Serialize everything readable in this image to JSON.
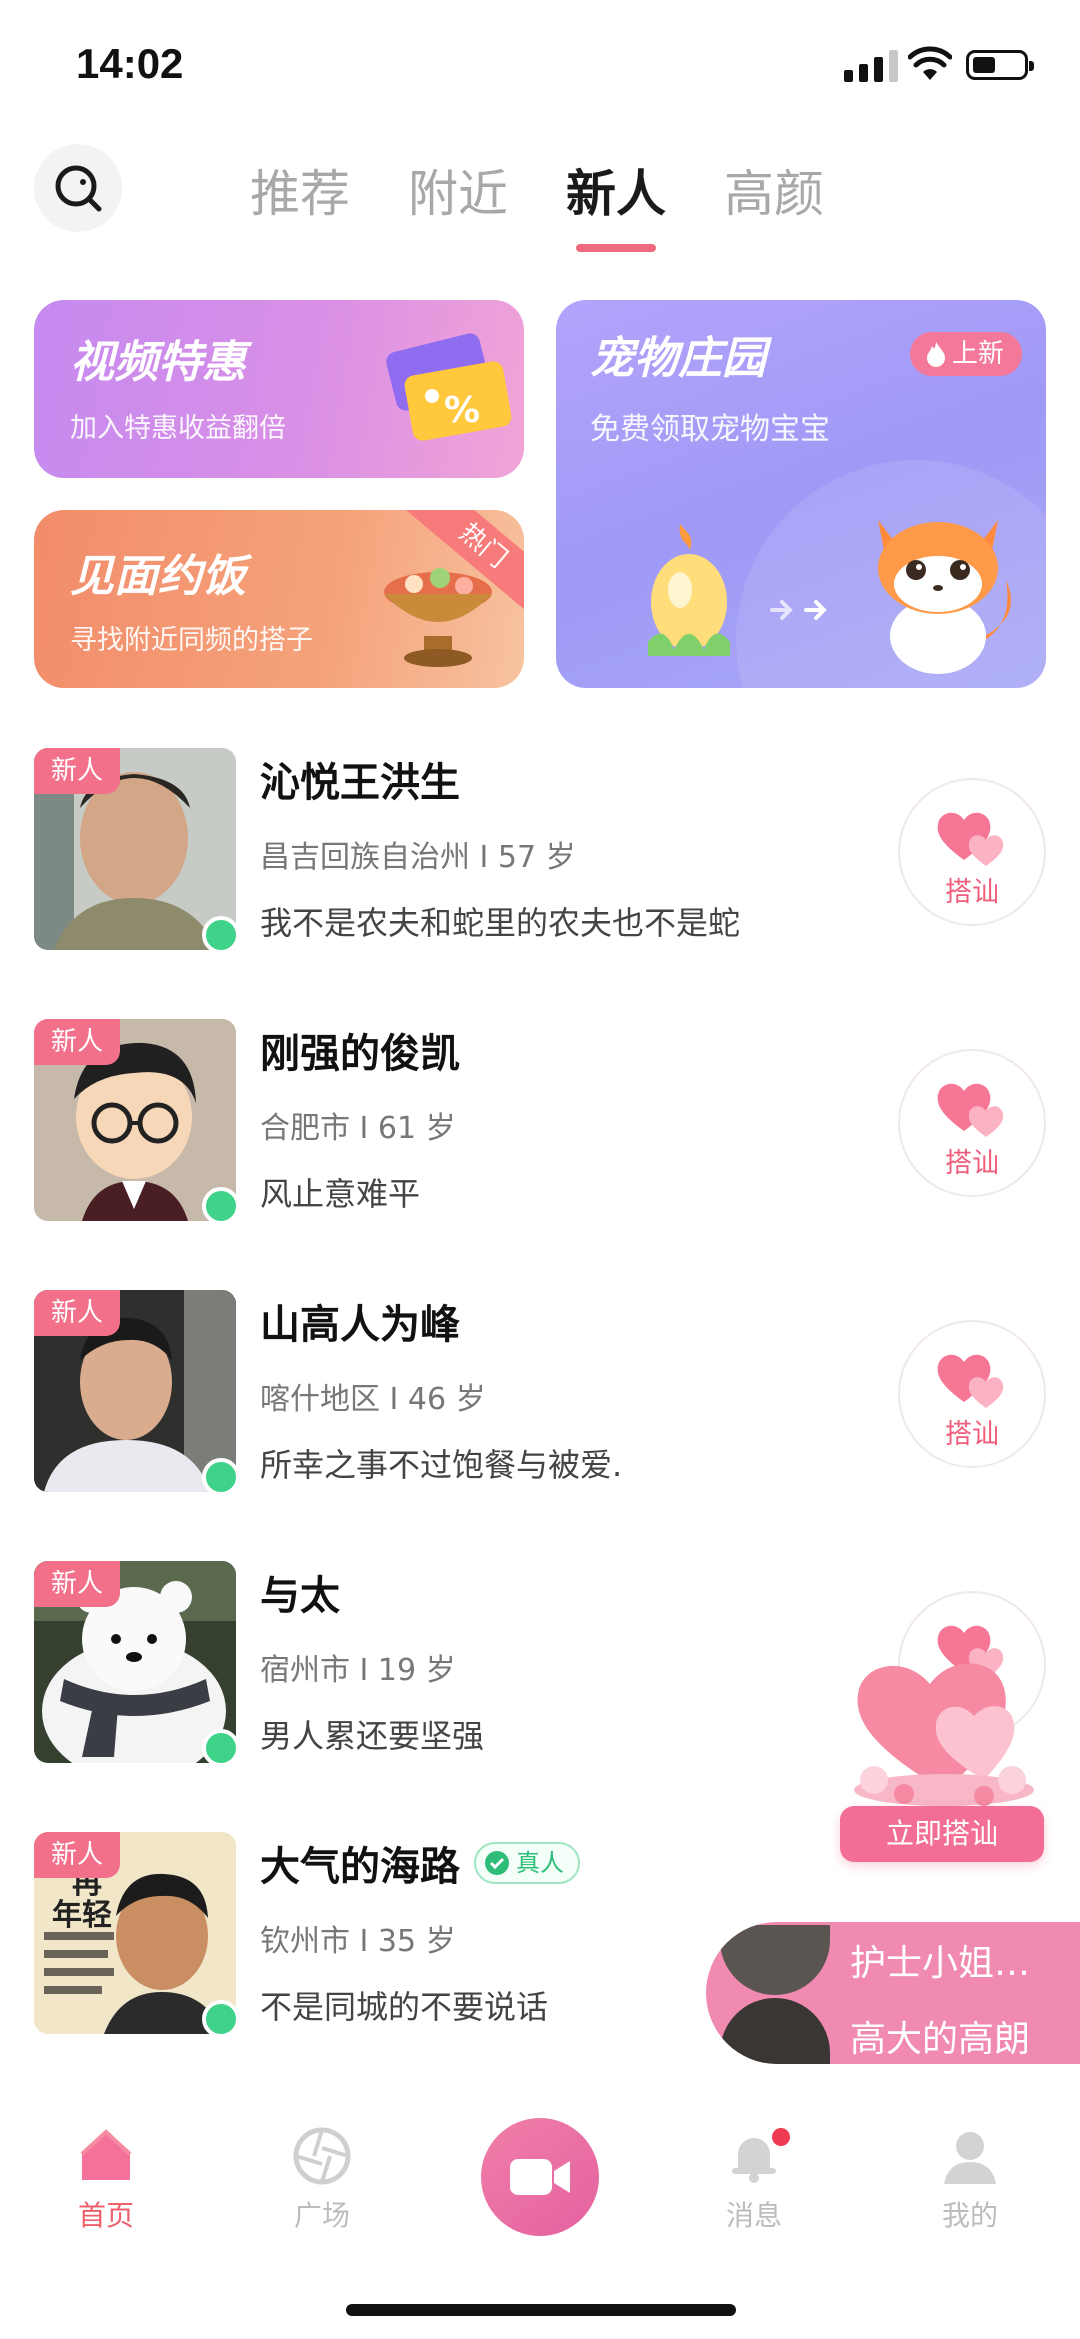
{
  "status_bar": {
    "time": "14:02"
  },
  "top_tabs": [
    {
      "label": "推荐",
      "active": false
    },
    {
      "label": "附近",
      "active": false
    },
    {
      "label": "新人",
      "active": true
    },
    {
      "label": "高颜",
      "active": false
    }
  ],
  "banners": {
    "video": {
      "title": "视频特惠",
      "subtitle": "加入特惠收益翻倍"
    },
    "meal": {
      "title": "见面约饭",
      "subtitle": "寻找附近同频的搭子",
      "ribbon": "热门"
    },
    "pet": {
      "title": "宠物庄园",
      "subtitle": "免费领取宠物宝宝",
      "badge": "上新"
    }
  },
  "list": [
    {
      "tag": "新人",
      "name": "沁悦王洪生",
      "meta": "昌吉回族自治州 I 57 岁",
      "bio": "我不是农夫和蛇里的农夫也不是蛇",
      "action": "搭讪"
    },
    {
      "tag": "新人",
      "name": "刚强的俊凯",
      "meta": "合肥市 I 61 岁",
      "bio": "风止意难平",
      "action": "搭讪"
    },
    {
      "tag": "新人",
      "name": "山高人为峰",
      "meta": "喀什地区 I 46 岁",
      "bio": "所幸之事不过饱餐与被爱.",
      "action": "搭讪"
    },
    {
      "tag": "新人",
      "name": "与太",
      "meta": "宿州市 I 19 岁",
      "bio": "男人累还要坚强",
      "action": "搭讪"
    },
    {
      "tag": "新人",
      "name": "大气的海路",
      "verified": "真人",
      "meta": "钦州市 I 35 岁",
      "bio": "不是同城的不要说话",
      "action": "搭讪"
    }
  ],
  "avatar5_text": {
    "line1": "再",
    "line2": "年轻"
  },
  "floating": {
    "button": "立即搭讪"
  },
  "ticker": [
    "护士小姐…",
    "高大的高朗"
  ],
  "bottom_nav": [
    {
      "label": "首页",
      "active": true
    },
    {
      "label": "广场",
      "active": false
    },
    {
      "label": "消息",
      "active": false
    },
    {
      "label": "我的",
      "active": false
    }
  ],
  "colors": {
    "accent": "#f06a7e",
    "online": "#3fd38a",
    "new_tag": "#f2708a"
  }
}
